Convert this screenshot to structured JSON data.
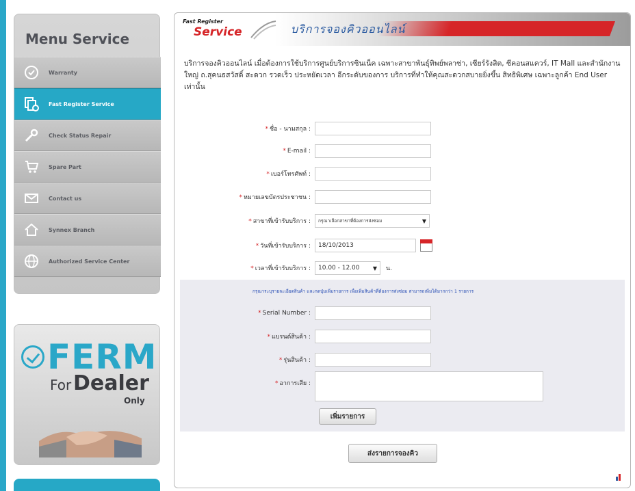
{
  "menu": {
    "title": "Menu Service",
    "items": [
      {
        "label": "Warranty",
        "icon": "warranty-icon",
        "active": false
      },
      {
        "label": "Fast Register Service",
        "icon": "register-icon",
        "active": true
      },
      {
        "label": "Check Status Repair",
        "icon": "wrench-icon",
        "active": false
      },
      {
        "label": "Spare Part",
        "icon": "cart-icon",
        "active": false
      },
      {
        "label": "Contact us",
        "icon": "mail-icon",
        "active": false
      },
      {
        "label": "Synnex Branch",
        "icon": "home-icon",
        "active": false
      },
      {
        "label": "Authorized Service Center",
        "icon": "globe-icon",
        "active": false
      }
    ]
  },
  "promo": {
    "brand": "FERM",
    "for": "For",
    "dealer": "Dealer",
    "only": "Only"
  },
  "banner": {
    "logo_small": "Fast Register",
    "logo_big": "Service",
    "title": "บริการจองคิวออนไลน์"
  },
  "intro": "บริการจองคิวออนไลน์ เมื่อต้องการใช้บริการศูนย์บริการซินเน็ค เฉพาะสาขาพันธุ์ทิพย์พลาซ่า, เซียร์รังสิต, ซีคอนสแควร์, IT Mall และสำนักงานใหญ่ ถ.สุคนธสวัสดิ์ สะดวก รวดเร็ว ประหยัดเวลา อีกระดับของการ บริการที่ทำให้คุณสะดวกสบายยิ่งขึ้น สิทธิพิเศษ เฉพาะลูกค้า End User เท่านั้น",
  "form": {
    "name_label": "ชื่อ - นามสกุล :",
    "email_label": "E-mail :",
    "phone_label": "เบอร์โทรศัพท์ :",
    "idcard_label": "หมายเลขบัตรประชาชน :",
    "branch_label": "สาขาที่เข้ารับบริการ :",
    "branch_value": "กรุณาเลือกสาขาที่ต้องการส่งซ่อม",
    "date_label": "วันที่เข้ารับบริการ :",
    "date_value": "18/10/2013",
    "time_label": "เวลาที่เข้ารับบริการ :",
    "time_value": "10.00 - 12.00",
    "time_unit": "น.",
    "product_note": "กรุณาระบุรายละเอียดสินค้า และกดปุ่มเพิ่มรายการ เพื่อเพิ่มสินค้าที่ต้องการส่งซ่อม สามารถเพิ่มได้มากกว่า 1 รายการ",
    "serial_label": "Serial Number :",
    "brand_label": "แบรนด์สินค้า :",
    "model_label": "รุ่นสินค้า :",
    "symptom_label": "อาการเสีย :",
    "add_button": "เพิ่มรายการ",
    "submit_button": "ส่งรายการจองคิว"
  }
}
